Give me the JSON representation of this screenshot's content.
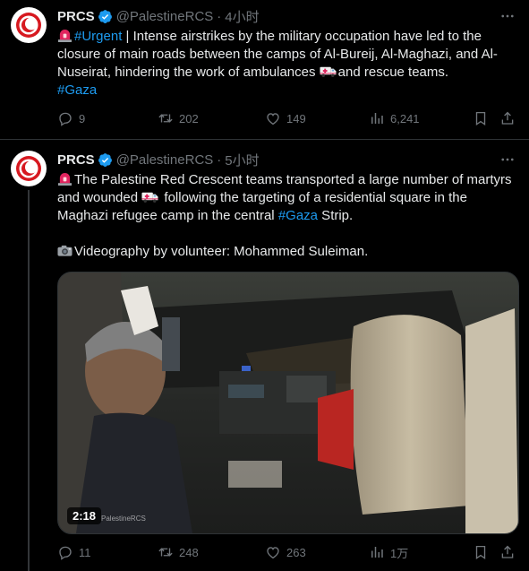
{
  "posts": [
    {
      "author_name": "PRCS",
      "handle": "@PalestineRCS",
      "separator": "·",
      "time": "4小时",
      "hashtag_urgent": "#Urgent",
      "text_part1": " | Intense airstrikes by the military occupation have led to the closure of main roads between the camps of Al-Bureij, Al-Maghazi, and Al-Nuseirat, hindering the work of ambulances ",
      "text_part2": "and rescue teams.",
      "hashtag_gaza": "#Gaza",
      "stats": {
        "replies": "9",
        "reposts": "202",
        "likes": "149",
        "views": "6,241"
      }
    },
    {
      "author_name": "PRCS",
      "handle": "@PalestineRCS",
      "separator": "·",
      "time": "5小时",
      "text_part1": "The Palestine Red Crescent teams transported a large number of martyrs and wounded ",
      "text_part2": " following the targeting of a residential square in the Maghazi refugee camp in the central ",
      "hashtag_gaza": "#Gaza",
      "text_part3": " Strip.",
      "text_line2": "Videography by volunteer: Mohammed Suleiman.",
      "video": {
        "duration": "2:18",
        "watermark": "PalestineRCS"
      },
      "stats": {
        "replies": "11",
        "reposts": "248",
        "likes": "263",
        "views": "1万"
      }
    }
  ],
  "colors": {
    "background": "#000000",
    "text": "#e7e9ea",
    "muted": "#71767b",
    "link": "#1d9bf0",
    "border": "#2f3336",
    "verified": "#1d9bf0"
  },
  "icons": [
    "siren-emoji",
    "ambulance-emoji",
    "camera-emoji",
    "verified-badge-icon",
    "more-icon",
    "reply-icon",
    "repost-icon",
    "like-icon",
    "views-icon",
    "bookmark-icon",
    "share-icon"
  ]
}
